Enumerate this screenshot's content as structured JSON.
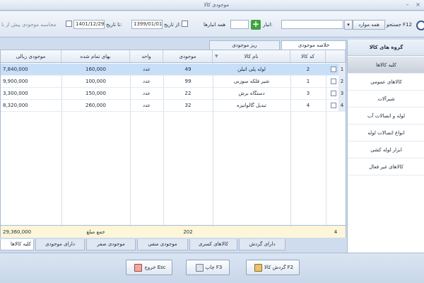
{
  "window": {
    "title": "موجودی کالا",
    "minimize": "–",
    "close": "×"
  },
  "toolbar": {
    "search_label": "جستجو F12",
    "filter_value": "همه موارد",
    "search_value": "",
    "warehouse_label": "انبار:",
    "warehouse_value": "",
    "all_warehouses_label": "همه انبارها",
    "from_date_label": "از تاریخ:",
    "from_date_value": "1399/01/01",
    "to_date_label": "تا تاریخ:",
    "to_date_value": "1401/12/29",
    "prior_balance_label": "محاسبه موجودی پیش از با",
    "dropdown_glyph": "▾",
    "plus_glyph": "+"
  },
  "groups": {
    "header": "گروه های کالا",
    "items": [
      "کلیه کالاها",
      "کالاهای عمومی",
      "شیرآلات",
      "لوله و اتصالات آب",
      "انواع اتصالات لوله",
      "ابزار لوله کشی",
      "کالاهای غیر فعال"
    ]
  },
  "top_tabs": [
    "خلاصه موجودی",
    "ریز موجودی"
  ],
  "table": {
    "columns": [
      "کد کالا",
      "نام کالا",
      "موجودی",
      "واحد",
      "بهای تمام شده",
      "موجودی ریالی"
    ],
    "sort_glyph": "▼",
    "rows": [
      {
        "no": "1",
        "code": "2",
        "name": "لوله پلی اتیلن",
        "qty": "49",
        "unit": "عدد",
        "cost": "160,000",
        "value": "7,840,000"
      },
      {
        "no": "2",
        "code": "1",
        "name": "شیر فلکه سوزنی",
        "qty": "99",
        "unit": "عدد",
        "cost": "100,000",
        "value": "9,900,000"
      },
      {
        "no": "3",
        "code": "3",
        "name": "دستگاه برش",
        "qty": "22",
        "unit": "عدد",
        "cost": "150,000",
        "value": "3,300,000"
      },
      {
        "no": "4",
        "code": "4",
        "name": "تبدیل گالوانیزه",
        "qty": "32",
        "unit": "عدد",
        "cost": "260,000",
        "value": "8,320,000"
      }
    ],
    "footer": {
      "count": "4",
      "total_qty": "202",
      "total_label": "جمع مبلغ",
      "total_value": "29,360,000"
    }
  },
  "bottom_tabs": [
    "دارای گردش",
    "کالاهای کسری",
    "موجودی منفی",
    "موجودی صفر",
    "دارای موجودی",
    "کلیه کالاها"
  ],
  "buttons": {
    "turnover": "گردش کالا F2",
    "print": "چاپ F3",
    "exit": "خروج Esc"
  }
}
